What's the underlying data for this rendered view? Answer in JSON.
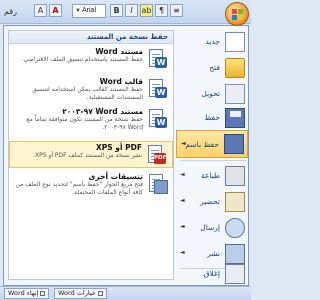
{
  "toolbar": {
    "ruler_label": "رقم",
    "font_name": "Arial"
  },
  "submenu": {
    "header": "حفظ نسخة من المستند",
    "items": [
      {
        "title": "مستند Word",
        "desc": "حفظ المستند باستخدام تنسيق الملف الافتراضي.",
        "icon": "word-document-icon"
      },
      {
        "title": "قالب Word",
        "desc": "حفظ المستند كقالب يمكن استخدامه لتنسيق المستندات المستقبلية.",
        "icon": "word-template-icon"
      },
      {
        "title": "مستند Word ٩٧-٢٠٠٣",
        "desc": "حفظ نسخة من المستند تكون متوافقة تماماً مع Word ٩٧-٢٠٠٣.",
        "icon": "word-97-2003-icon"
      },
      {
        "title": "PDF أو XPS",
        "desc": "نشر نسخة من المستند كملف PDF أو XPS.",
        "icon": "pdf-xps-icon"
      },
      {
        "title": "تنسيقات أخرى",
        "desc": "فتح مربع الحوار \"حفظ باسم\" لتحديد نوع الملف من كافة أنواع الملفات المحتملة.",
        "icon": "other-formats-icon"
      }
    ]
  },
  "main_menu": {
    "items": [
      {
        "label": "جديد",
        "icon": "new-document-icon",
        "arrow": ""
      },
      {
        "label": "فتح",
        "icon": "open-folder-icon",
        "arrow": ""
      },
      {
        "label": "تحويل",
        "icon": "convert-icon",
        "arrow": ""
      },
      {
        "label": "حفظ",
        "icon": "save-icon",
        "arrow": ""
      },
      {
        "label": "حفظ باسم",
        "icon": "save-as-icon",
        "arrow": "◄"
      },
      {
        "label": "طباعة",
        "icon": "print-icon",
        "arrow": "◄"
      },
      {
        "label": "تحضير",
        "icon": "prepare-icon",
        "arrow": "◄"
      },
      {
        "label": "إرسال",
        "icon": "send-icon",
        "arrow": "◄"
      },
      {
        "label": "نشر",
        "icon": "publish-icon",
        "arrow": "◄"
      },
      {
        "label": "إغلاق",
        "icon": "close-document-icon",
        "arrow": ""
      }
    ]
  },
  "taskbar": {
    "buttons": [
      {
        "label": "Word خيارات"
      },
      {
        "label": "Word إنهاء"
      }
    ]
  }
}
